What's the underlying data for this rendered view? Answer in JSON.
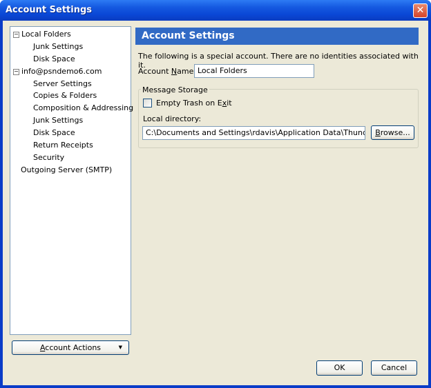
{
  "window": {
    "title": "Account Settings",
    "close_glyph": "✕"
  },
  "tree": [
    {
      "label": "Local Folders",
      "level": 0,
      "expander": "−"
    },
    {
      "label": "Junk Settings",
      "level": 1
    },
    {
      "label": "Disk Space",
      "level": 1
    },
    {
      "label": "info@psndemo6.com",
      "level": 0,
      "expander": "−"
    },
    {
      "label": "Server Settings",
      "level": 1
    },
    {
      "label": "Copies & Folders",
      "level": 1
    },
    {
      "label": "Composition & Addressing",
      "level": 1
    },
    {
      "label": "Junk Settings",
      "level": 1
    },
    {
      "label": "Disk Space",
      "level": 1
    },
    {
      "label": "Return Receipts",
      "level": 1
    },
    {
      "label": "Security",
      "level": 1
    },
    {
      "label": "Outgoing Server (SMTP)",
      "level": 0
    }
  ],
  "account_actions": {
    "label_a": "A",
    "label_rest": "ccount Actions",
    "arrow": "▼"
  },
  "panel": {
    "header": "Account Settings",
    "description": "The following is a special account. There are no identities associated with it.",
    "account_name": {
      "label_pre": "Account ",
      "label_accel": "N",
      "label_post": "ame:",
      "value": "Local Folders"
    },
    "message_storage": {
      "title": "Message Storage",
      "empty_trash": {
        "label_pre": "Empty Trash on E",
        "label_accel": "x",
        "label_post": "it",
        "checked": false
      },
      "local_directory_label": "Local directory:",
      "local_directory_value": "C:\\Documents and Settings\\rdavis\\Application Data\\Thunderbird\\Pr",
      "browse": {
        "label_accel": "B",
        "label_rest": "rowse..."
      }
    }
  },
  "buttons": {
    "ok": "OK",
    "cancel": "Cancel"
  }
}
